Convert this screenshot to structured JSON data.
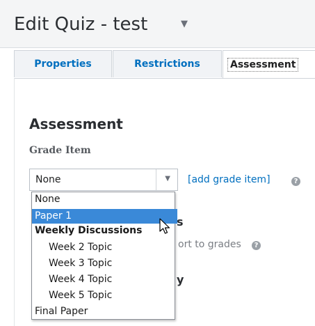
{
  "header": {
    "title": "Edit Quiz - test",
    "menu_icon": "chevron-down-icon"
  },
  "tabs": [
    {
      "label": "Properties"
    },
    {
      "label": "Restrictions"
    },
    {
      "label": "Assessment",
      "active": true
    }
  ],
  "assessment": {
    "section_title": "Assessment",
    "grade_item_label": "Grade Item",
    "grade_item_value": "None",
    "add_grade_item": "[add grade item]",
    "obscured_text": {
      "fragment_s": "s",
      "fragment_grades": "ort to grades",
      "fragment_y": "y"
    }
  },
  "dropdown": {
    "options": [
      {
        "label": "None"
      },
      {
        "label": "Paper 1",
        "selected": true
      },
      {
        "label": "Weekly Discussions",
        "group": true
      },
      {
        "label": "Week 2 Topic"
      },
      {
        "label": "Week 3 Topic"
      },
      {
        "label": "Week 4 Topic"
      },
      {
        "label": "Week 5 Topic"
      },
      {
        "label": "Final Paper"
      }
    ]
  },
  "colors": {
    "link": "#006fbf",
    "selection": "#3a89d8"
  }
}
